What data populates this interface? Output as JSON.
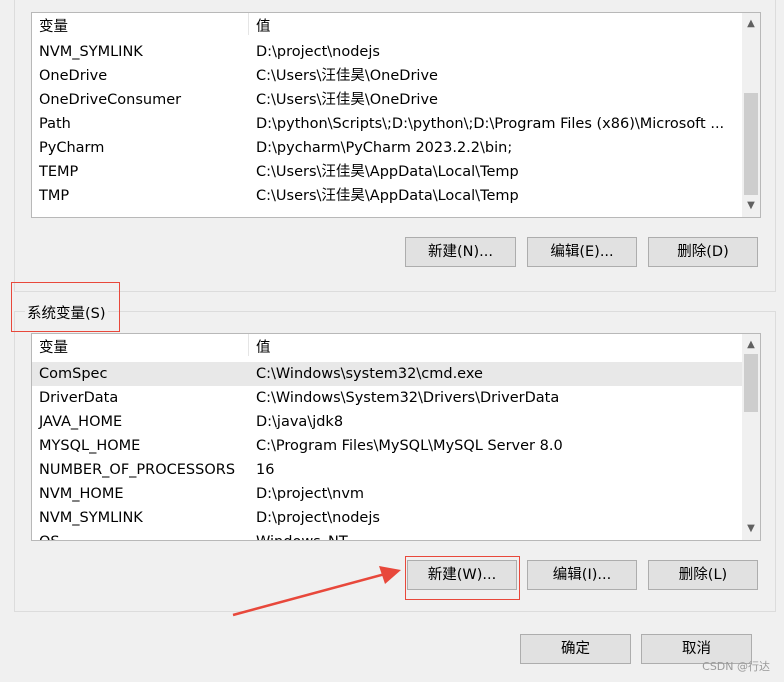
{
  "user_vars": {
    "headers": {
      "name": "变量",
      "value": "值"
    },
    "rows": [
      {
        "name": "NVM_SYMLINK",
        "value": "D:\\project\\nodejs"
      },
      {
        "name": "OneDrive",
        "value": "C:\\Users\\汪佳昊\\OneDrive"
      },
      {
        "name": "OneDriveConsumer",
        "value": "C:\\Users\\汪佳昊\\OneDrive"
      },
      {
        "name": "Path",
        "value": "D:\\python\\Scripts\\;D:\\python\\;D:\\Program Files (x86)\\Microsoft ..."
      },
      {
        "name": "PyCharm",
        "value": "D:\\pycharm\\PyCharm 2023.2.2\\bin;"
      },
      {
        "name": "TEMP",
        "value": "C:\\Users\\汪佳昊\\AppData\\Local\\Temp"
      },
      {
        "name": "TMP",
        "value": "C:\\Users\\汪佳昊\\AppData\\Local\\Temp"
      }
    ],
    "buttons": {
      "new": "新建(N)...",
      "edit": "编辑(E)...",
      "delete": "删除(D)"
    }
  },
  "system_vars": {
    "group_label": "系统变量(S)",
    "headers": {
      "name": "变量",
      "value": "值"
    },
    "rows": [
      {
        "name": "ComSpec",
        "value": "C:\\Windows\\system32\\cmd.exe"
      },
      {
        "name": "DriverData",
        "value": "C:\\Windows\\System32\\Drivers\\DriverData"
      },
      {
        "name": "JAVA_HOME",
        "value": "D:\\java\\jdk8"
      },
      {
        "name": "MYSQL_HOME",
        "value": "C:\\Program Files\\MySQL\\MySQL Server 8.0"
      },
      {
        "name": "NUMBER_OF_PROCESSORS",
        "value": "16"
      },
      {
        "name": "NVM_HOME",
        "value": "D:\\project\\nvm"
      },
      {
        "name": "NVM_SYMLINK",
        "value": "D:\\project\\nodejs"
      },
      {
        "name": "OS",
        "value": "Windows_NT"
      }
    ],
    "buttons": {
      "new": "新建(W)...",
      "edit": "编辑(I)...",
      "delete": "删除(L)"
    }
  },
  "dialog_buttons": {
    "ok": "确定",
    "cancel": "取消"
  },
  "watermark": "CSDN @行达",
  "annotation_color": "#e8483b"
}
